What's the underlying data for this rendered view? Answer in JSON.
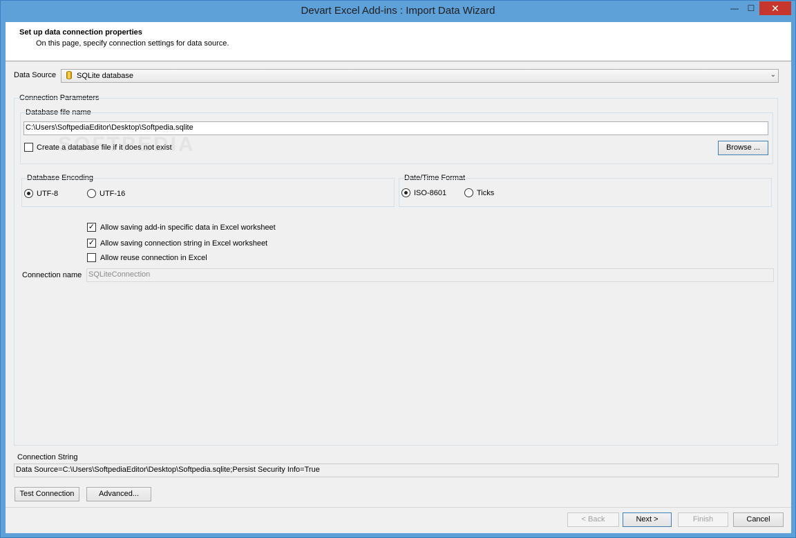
{
  "window": {
    "title": "Devart Excel Add-ins : Import Data Wizard",
    "minimize_glyph": "—",
    "maximize_glyph": "☐",
    "close_glyph": "✕"
  },
  "header": {
    "title": "Set up data connection properties",
    "subtitle": "On this page, specify connection settings for data source."
  },
  "data_source": {
    "label": "Data Source",
    "value": "SQLite database",
    "icon": "database-icon",
    "arrow_glyph": "⌄"
  },
  "connection_params": {
    "title": "Connection Parameters",
    "db_file": {
      "label": "Database file name",
      "value": "C:\\Users\\SoftpediaEditor\\Desktop\\Softpedia.sqlite",
      "create_label": "Create a database file if it does not exist",
      "create_checked": false,
      "browse_label": "Browse ..."
    },
    "encoding": {
      "title": "Database Encoding",
      "options": [
        "UTF-8",
        "UTF-16"
      ],
      "selected": "UTF-8"
    },
    "datetime": {
      "title": "Date/Time Format",
      "options": [
        "ISO-8601",
        "Ticks"
      ],
      "selected": "ISO-8601"
    },
    "allow_saving_addin_label": "Allow saving add-in specific data in Excel worksheet",
    "allow_saving_addin_checked": true,
    "allow_saving_connstr_label": "Allow saving connection string in Excel worksheet",
    "allow_saving_connstr_checked": true,
    "allow_reuse_label": "Allow reuse connection in Excel",
    "allow_reuse_checked": false,
    "check_glyph": "✓",
    "connection_name_label": "Connection name",
    "connection_name_value": "SQLiteConnection"
  },
  "watermark": "SOFTPEDIA",
  "connection_string": {
    "label": "Connection String",
    "value": "Data Source=C:\\Users\\SoftpediaEditor\\Desktop\\Softpedia.sqlite;Persist Security Info=True"
  },
  "buttons": {
    "test_connection": "Test Connection",
    "advanced": "Advanced...",
    "back": "< Back",
    "next": "Next >",
    "finish": "Finish",
    "cancel": "Cancel"
  }
}
